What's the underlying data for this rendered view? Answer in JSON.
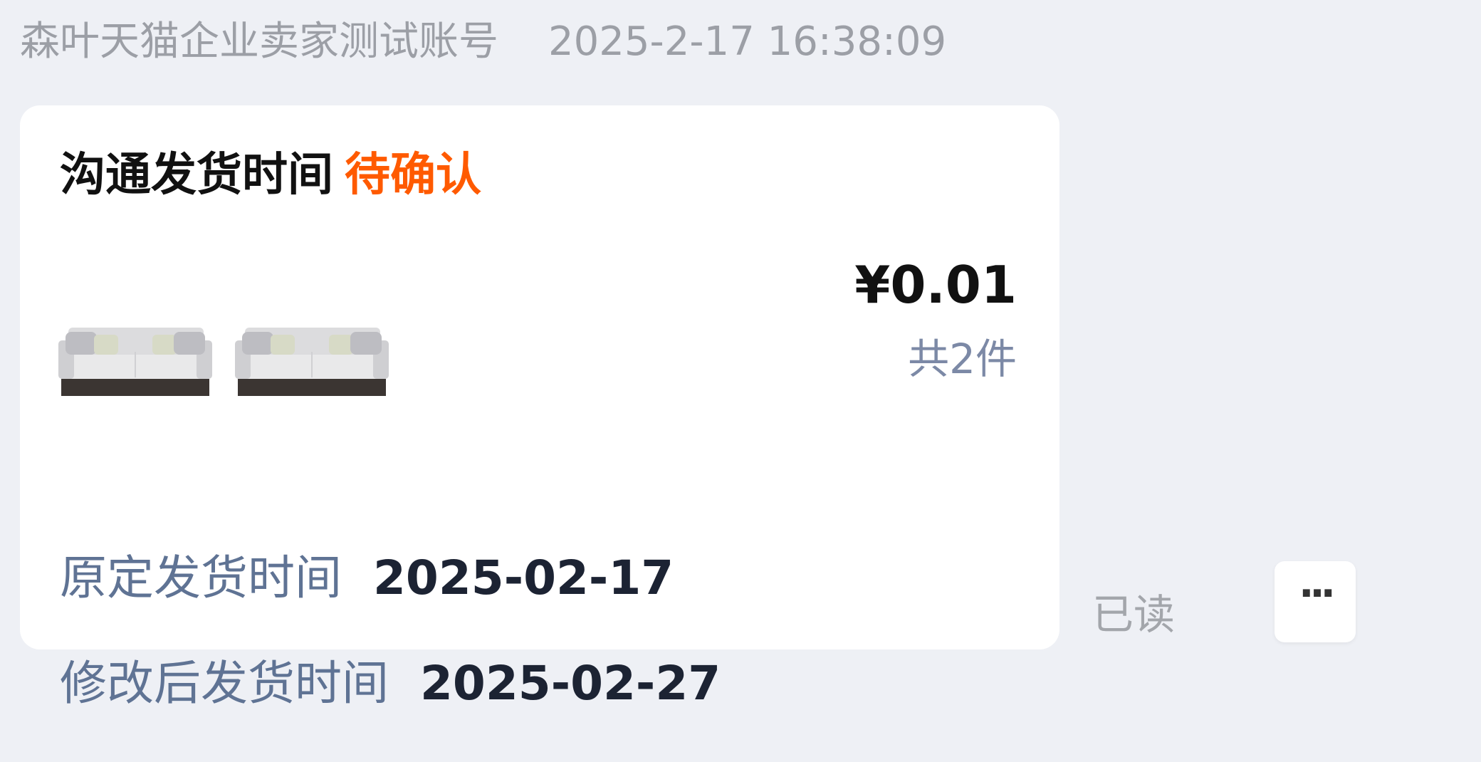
{
  "message": {
    "sender": "森叶天猫企业卖家测试账号",
    "timestamp": "2025-2-17 16:38:09"
  },
  "card": {
    "title": "沟通发货时间",
    "status": "待确认",
    "status_color": "#ff5a00",
    "price": "¥0.01",
    "item_count": "共2件",
    "products": [
      {
        "icon": "sofa-thumbnail"
      },
      {
        "icon": "sofa-thumbnail"
      }
    ],
    "original_ship_label": "原定发货时间",
    "original_ship_date": "2025-02-17",
    "modified_ship_label": "修改后发货时间",
    "modified_ship_date": "2025-02-27"
  },
  "read_status": "已读",
  "more_button": {
    "icon": "more-dots-icon",
    "glyph": "···"
  }
}
